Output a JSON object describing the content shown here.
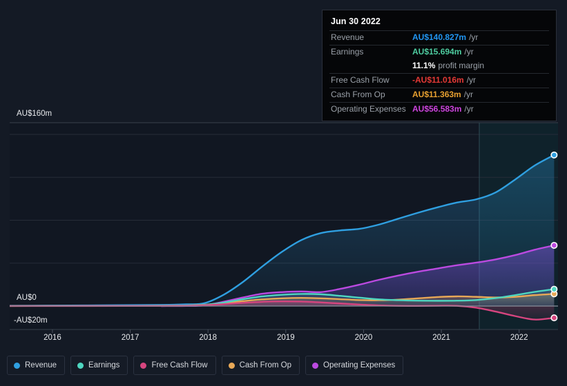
{
  "tooltip": {
    "date": "Jun 30 2022",
    "rows": [
      {
        "label": "Revenue",
        "value": "AU$140.827m",
        "unit": "/yr",
        "color": "#2196f3"
      },
      {
        "label": "Earnings",
        "value": "AU$15.694m",
        "unit": "/yr",
        "color": "#4ecca0"
      },
      {
        "label": "",
        "value": "11.1%",
        "unit": "profit margin",
        "color": "#ffffff"
      },
      {
        "label": "Free Cash Flow",
        "value": "-AU$11.016m",
        "unit": "/yr",
        "color": "#e53935"
      },
      {
        "label": "Cash From Op",
        "value": "AU$11.363m",
        "unit": "/yr",
        "color": "#e8a030"
      },
      {
        "label": "Operating Expenses",
        "value": "AU$56.583m",
        "unit": "/yr",
        "color": "#cc44dd"
      }
    ]
  },
  "legend": {
    "items": [
      {
        "label": "Revenue",
        "color": "#2f9fe0"
      },
      {
        "label": "Earnings",
        "color": "#4ed6c0"
      },
      {
        "label": "Free Cash Flow",
        "color": "#d6457f"
      },
      {
        "label": "Cash From Op",
        "color": "#e8a857"
      },
      {
        "label": "Operating Expenses",
        "color": "#bb4ae0"
      }
    ]
  },
  "axes": {
    "y_top_label": "AU$160m",
    "y_zero_label": "AU$0",
    "y_bottom_label": "-AU$20m",
    "x_labels": [
      "2016",
      "2017",
      "2018",
      "2019",
      "2020",
      "2021",
      "2022"
    ]
  },
  "chart_data": {
    "type": "area",
    "title": "",
    "xlabel": "",
    "ylabel": "AU$ (millions)",
    "ylim": [
      -20,
      160
    ],
    "xlim": [
      2015.45,
      2022.5
    ],
    "grid": true,
    "legend_position": "bottom",
    "highlight_region_start": 2021.5,
    "tick_years": [
      2016,
      2017,
      2018,
      2019,
      2020,
      2021,
      2022
    ],
    "x": [
      2015.45,
      2015.9,
      2016.4,
      2016.9,
      2017.4,
      2017.72,
      2017.95,
      2018.2,
      2018.45,
      2018.7,
      2018.95,
      2019.2,
      2019.45,
      2019.7,
      2019.95,
      2020.2,
      2020.45,
      2020.7,
      2020.95,
      2021.2,
      2021.45,
      2021.7,
      2021.95,
      2022.2,
      2022.45
    ],
    "series": [
      {
        "name": "Revenue",
        "color": "#2f9fe0",
        "values": [
          0.3,
          0.4,
          0.6,
          0.8,
          1.1,
          1.6,
          2.6,
          10.5,
          22.5,
          37.0,
          50.5,
          61.5,
          68.0,
          70.5,
          72.0,
          76.0,
          81.5,
          87.0,
          92.0,
          96.5,
          99.5,
          106.0,
          118.0,
          131.0,
          140.827
        ]
      },
      {
        "name": "Earnings",
        "color": "#4ed6c0",
        "values": [
          0.1,
          0.12,
          0.15,
          0.2,
          0.3,
          0.5,
          1.0,
          3.2,
          6.4,
          9.0,
          10.5,
          11.3,
          11.0,
          9.5,
          7.8,
          6.2,
          5.4,
          5.0,
          4.9,
          5.0,
          5.6,
          7.4,
          10.2,
          13.2,
          15.694
        ]
      },
      {
        "name": "Free Cash Flow",
        "color": "#d6457f",
        "values": [
          0.05,
          0.06,
          0.08,
          0.1,
          0.15,
          0.3,
          0.7,
          1.8,
          3.0,
          4.0,
          4.4,
          4.2,
          3.4,
          2.4,
          1.4,
          0.6,
          0.2,
          0.1,
          0.3,
          0.2,
          -1.6,
          -5.2,
          -9.4,
          -12.6,
          -11.016
        ]
      },
      {
        "name": "Cash From Op",
        "color": "#e8a857",
        "values": [
          0.08,
          0.1,
          0.12,
          0.18,
          0.25,
          0.5,
          1.2,
          2.8,
          4.6,
          6.2,
          7.2,
          7.6,
          7.2,
          6.4,
          5.6,
          5.4,
          6.0,
          7.2,
          8.4,
          9.0,
          8.6,
          8.0,
          8.6,
          10.2,
          11.363
        ]
      },
      {
        "name": "Operating Expenses",
        "color": "#bb4ae0",
        "values": [
          null,
          null,
          null,
          null,
          0.0,
          0.1,
          0.6,
          4.0,
          8.0,
          11.5,
          13.0,
          13.6,
          13.0,
          16.0,
          20.0,
          24.5,
          28.5,
          32.0,
          35.0,
          38.0,
          40.5,
          43.5,
          47.5,
          52.5,
          56.583
        ]
      }
    ]
  }
}
